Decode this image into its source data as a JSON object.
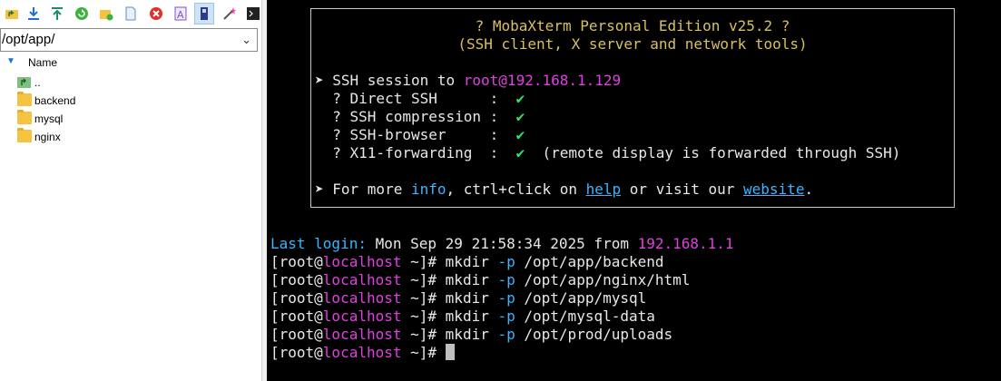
{
  "toolbar": {
    "icons": [
      "parent-dir-icon",
      "download-icon",
      "upload-icon",
      "refresh-icon",
      "new-folder-icon",
      "new-file-icon",
      "delete-icon",
      "rename-icon",
      "text-editor-icon",
      "magic-wand-icon",
      "terminal-icon"
    ]
  },
  "filebrowser": {
    "path": "/opt/app/",
    "column_name": "Name",
    "items": [
      {
        "name": "..",
        "type": "parent"
      },
      {
        "name": "backend",
        "type": "folder"
      },
      {
        "name": "mysql",
        "type": "folder"
      },
      {
        "name": "nginx",
        "type": "folder"
      }
    ]
  },
  "terminal": {
    "banner": {
      "title": "? MobaXterm Personal Edition v25.2 ?",
      "subtitle": "(SSH client, X server and network tools)",
      "session_prefix": "SSH session to ",
      "session_target": "root@192.168.1.129",
      "features": [
        {
          "label": "? Direct SSH      :",
          "check": "✔",
          "note": ""
        },
        {
          "label": "? SSH compression :",
          "check": "✔",
          "note": ""
        },
        {
          "label": "? SSH-browser     :",
          "check": "✔",
          "note": ""
        },
        {
          "label": "? X11-forwarding  :",
          "check": "✔",
          "note": "(remote display is forwarded through SSH)"
        }
      ],
      "more_prefix": "For more ",
      "more_info": "info",
      "more_mid": ", ctrl+click on ",
      "more_help": "help",
      "more_or": " or visit our ",
      "more_website": "website",
      "more_end": "."
    },
    "last_login_label": "Last login:",
    "last_login_date": "Mon Sep 29 21:58:34 2025 from ",
    "last_login_ip": "192.168.1.1",
    "prompt_open": "[root@",
    "prompt_host": "localhost",
    "prompt_close": " ~]#",
    "commands": [
      {
        "cmd": "mkdir",
        "flag": "-p",
        "arg": "/opt/app/backend"
      },
      {
        "cmd": "mkdir",
        "flag": "-p",
        "arg": "/opt/app/nginx/html"
      },
      {
        "cmd": "mkdir",
        "flag": "-p",
        "arg": "/opt/app/mysql"
      },
      {
        "cmd": "mkdir",
        "flag": "-p",
        "arg": "/opt/mysql-data"
      },
      {
        "cmd": "mkdir",
        "flag": "-p",
        "arg": "/opt/prod/uploads"
      }
    ]
  }
}
